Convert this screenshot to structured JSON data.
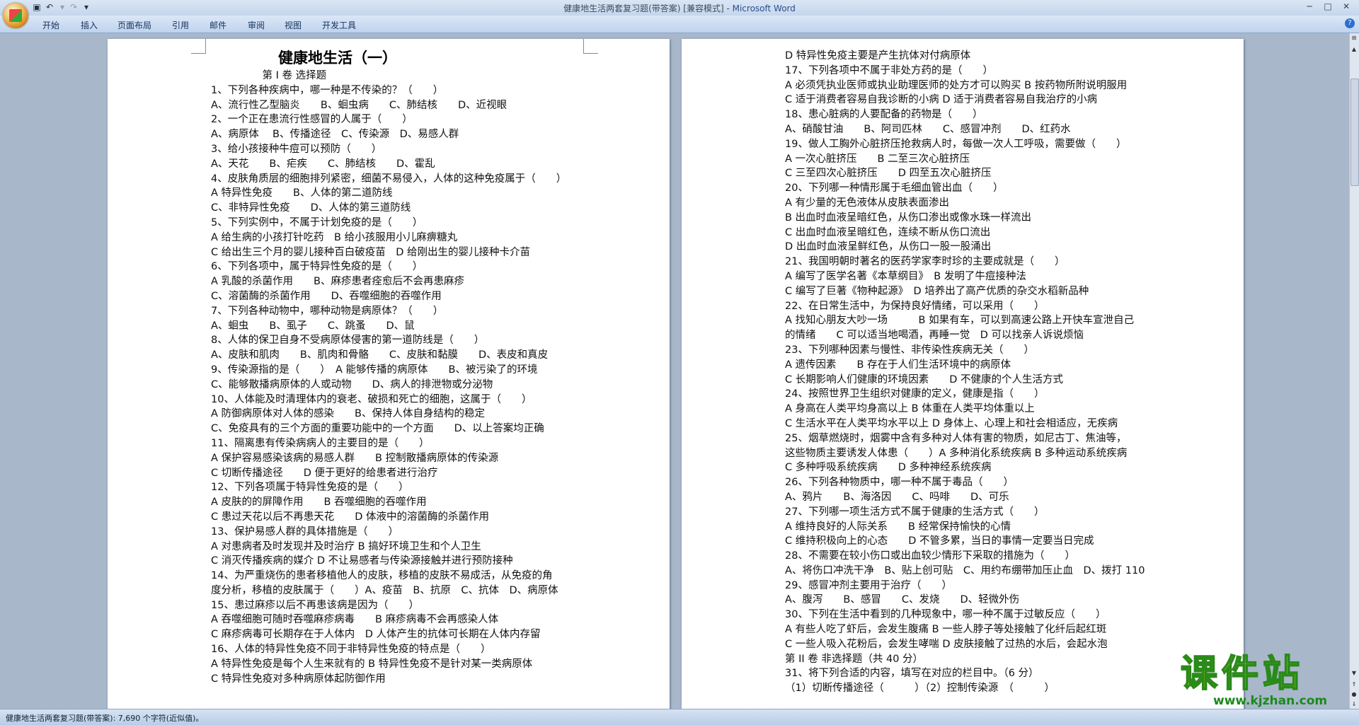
{
  "window": {
    "title": "健康地生活两套复习题(带答案) [兼容模式] - ",
    "app": "Microsoft Word"
  },
  "ribbon": {
    "tabs": [
      "开始",
      "插入",
      "页面布局",
      "引用",
      "邮件",
      "审阅",
      "视图",
      "开发工具"
    ]
  },
  "icons": {
    "office": "office-button-icon",
    "save": "save-icon",
    "undo": "undo-icon",
    "redo": "redo-icon",
    "customize": "chevron-down-icon",
    "minimize": "minimize-icon",
    "maximize": "maximize-icon",
    "close": "close-icon",
    "help": "help-icon"
  },
  "page1": {
    "title": "健康地生活（一）",
    "lines": [
      "　　　　　第 I 卷 选择题",
      "1、下列各种疾病中，哪一种是不传染的？（　　）",
      "A、流行性乙型脑炎　　B、蛔虫病　　C、肺结核　　D、近视眼",
      "2、一个正在患流行性感冒的人属于（　　）",
      "A、病原体　 B、传播途径　C、传染源　D、易感人群",
      "3、给小孩接种牛痘可以预防（　　）",
      "A、天花　　B、疟疾　　C、肺结核　　D、霍乱",
      "4、皮肤角质层的细胞排列紧密，细菌不易侵入，人体的这种免疫属于（　　）",
      "A 特异性免疫　　B、人体的第二道防线",
      "C、非特异性免疫　　D、人体的第三道防线",
      "5、下列实例中，不属于计划免疫的是（　　）",
      "A 给生病的小孩打针吃药　B 给小孩服用小儿麻痹糖丸",
      "C 给出生三个月的婴儿接种百白破疫苗　D 给刚出生的婴儿接种卡介苗",
      "6、下列各项中，属于特异性免疫的是（　　）",
      "A 乳酸的杀菌作用　　B、麻疹患者痊愈后不会再患麻疹",
      "C、溶菌酶的杀菌作用　　D、吞噬细胞的吞噬作用",
      "7、下列各种动物中，哪种动物是病原体？（　　）",
      "A、蛔虫　　B、虱子　　C、跳蚤　　D、鼠",
      "8、人体的保卫自身不受病原体侵害的第一道防线是（　　）",
      "A、皮肤和肌肉　　B、肌肉和骨骼　　C、皮肤和黏膜　　D、表皮和真皮",
      "9、传染源指的是（　　）　A 能够传播的病原体　　B、被污染了的环境",
      "C、能够散播病原体的人或动物　　D、病人的排泄物或分泌物",
      "10、人体能及时清理体内的衰老、破损和死亡的细胞，这属于（　　）",
      "A 防御病原体对人体的感染　　B、保持人体自身结构的稳定",
      "C、免疫具有的三个方面的重要功能中的一个方面　　D、以上答案均正确",
      "11、隔离患有传染病病人的主要目的是（　　）",
      "A 保护容易感染该病的易感人群　　B 控制散播病原体的传染源",
      "C 切断传播途径　　D 便于更好的给患者进行治疗",
      "12、下列各项属于特异性免疫的是（　　）",
      "A 皮肤的的屏障作用　　B 吞噬细胞的吞噬作用",
      "C 患过天花以后不再患天花　　D 体液中的溶菌酶的杀菌作用",
      "13、保护易感人群的具体措施是（　　）",
      "A 对患病者及时发现并及时治疗 B 搞好环境卫生和个人卫生",
      "C 消灭传播疾病的媒介 D 不让易感者与传染源接触并进行预防接种",
      "14、为严重烧伤的患者移植他人的皮肤，移植的皮肤不易成活，从免疫的角",
      "度分析，移植的皮肤属于（　　）A、疫苗　B、抗原　C、抗体　D、病原体",
      "15、患过麻疹以后不再患该病是因为（　　）",
      "A 吞噬细胞可随时吞噬麻疹病毒　　B 麻疹病毒不会再感染人体",
      "C 麻疹病毒可长期存在于人体内　D 人体产生的抗体可长期在人体内存留",
      "16、人体的特异性免疫不同于非特异性免疫的特点是（　　）",
      "A 特异性免疫是每个人生来就有的 B 特异性免疫不是针对某一类病原体",
      "C 特异性免疫对多种病原体起防御作用"
    ]
  },
  "page2": {
    "lines": [
      "D 特异性免疫主要是产生抗体对付病原体",
      "17、下列各项中不属于非处方药的是（　　）",
      "A 必须凭执业医师或执业助理医师的处方才可以购买 B 按药物所附说明服用",
      "C 适于消费者容易自我诊断的小病 D 适于消费者容易自我治疗的小病",
      "18、患心脏病的人要配备的药物是（　　）",
      "A、硝酸甘油　　B、阿司匹林　　C、感冒冲剂　　D、红药水",
      "19、做人工胸外心脏挤压抢救病人时，每做一次人工呼吸，需要做（　　）",
      "A 一次心脏挤压　　B 二至三次心脏挤压",
      "C 三至四次心脏挤压　　D 四至五次心脏挤压",
      "20、下列哪一种情形属于毛细血管出血（　　）",
      "A 有少量的无色液体从皮肤表面渗出",
      "B 出血时血液呈暗红色，从伤口渗出或像水珠一样流出",
      "C 出血时血液呈暗红色，连续不断从伤口流出",
      "D 出血时血液呈鲜红色，从伤口一股一股涌出",
      "21、我国明朝时著名的医药学家李时珍的主要成就是（　　）",
      "A 编写了医学名著《本草纲目》　B 发明了牛痘接种法",
      "C 编写了巨著《物种起源》　D 培养出了高产优质的杂交水稻新品种",
      "22、在日常生活中，为保持良好情绪，可以采用（　　）",
      "A 找知心朋友大吵一场　　　B 如果有车，可以到高速公路上开快车宣泄自己",
      "的情绪　　C 可以适当地喝酒，再睡一觉　D 可以找亲人诉说烦恼",
      "23、下列哪种因素与慢性、非传染性疾病无关（　　）",
      "A 遗传因素　　B 存在于人们生活环境中的病原体",
      "C 长期影响人们健康的环境因素　　D 不健康的个人生活方式",
      "24、按照世界卫生组织对健康的定义，健康是指（　　）",
      "A 身高在人类平均身高以上 B 体重在人类平均体重以上",
      "C 生活水平在人类平均水平以上 D 身体上、心理上和社会相适应，无疾病",
      "25、烟草燃烧时，烟雾中含有多种对人体有害的物质，如尼古丁、焦油等，",
      "这些物质主要诱发人体患（　　）A 多种消化系统疾病 B 多种运动系统疾病",
      "C 多种呼吸系统疾病　　D 多种神经系统疾病",
      "26、下列各种物质中，哪一种不属于毒品（　　）",
      "A、鸦片　　B、海洛因　　C、吗啡　　D、可乐",
      "27、下列哪一项生活方式不属于健康的生活方式（　　）",
      "A 维持良好的人际关系　　B 经常保持愉快的心情",
      "C 维持积极向上的心态　　D 不管多累，当日的事情一定要当日完成",
      "28、不需要在较小伤口或出血较少情形下采取的措施为（　　）",
      "A、将伤口冲洗干净　B、贴上创可贴　C、用约布绷带加压止血　D、拨打 110",
      "29、感冒冲剂主要用于治疗（　　）",
      "A、腹泻　　B、感冒　　C、发烧　　D、轻微外伤",
      "30、下列在生活中看到的几种现象中，哪一种不属于过敏反应（　　）",
      "A 有些人吃了虾后，会发生腹痛 B 一些人脖子等处接触了化纤后起红斑",
      "C 一些人吸入花粉后，会发生哮喘 D 皮肤接触了过热的水后，会起水泡",
      "第 II 卷 非选择题（共 40 分）",
      "31、将下列合适的内容，填写在对应的栏目中。（6 分）",
      "（1）切断传播途径（　　　）（2）控制传染源　（　　　）"
    ]
  },
  "status": {
    "text": "健康地生活两套复习题(带答案): 7,690 个字符(近似值)。"
  },
  "watermark": {
    "main": "课件站",
    "url": "www.kjzhan.com"
  }
}
